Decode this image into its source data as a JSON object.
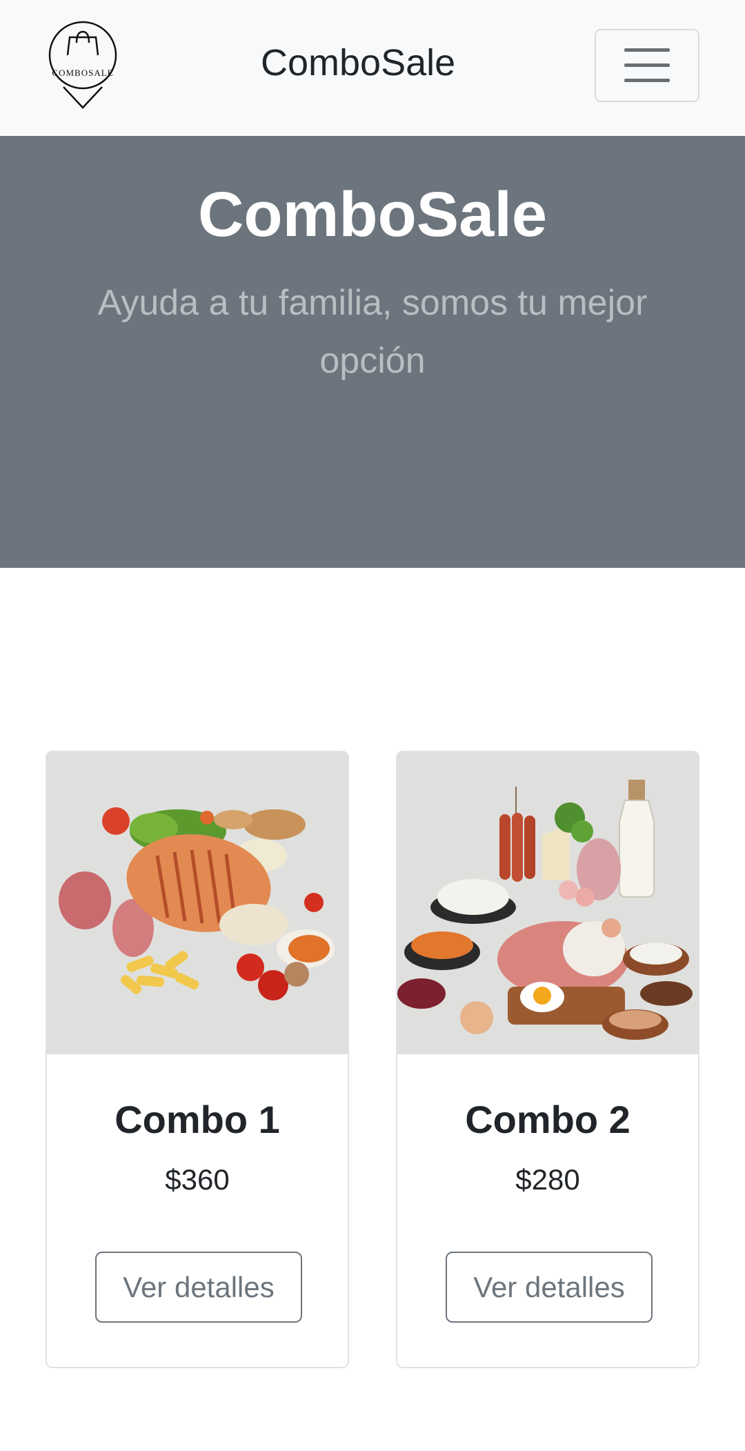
{
  "navbar": {
    "logo_text": "COMBOSALE",
    "brand": "ComboSale",
    "menu_button_icon": "hamburger-menu-icon"
  },
  "hero": {
    "title": "ComboSale",
    "subtitle": "Ayuda a tu familia, somos tu mejor opción"
  },
  "products": [
    {
      "title": "Combo 1",
      "price": "$360",
      "button_label": "Ver detalles",
      "image": "grilled-meat-vegetables-photo"
    },
    {
      "title": "Combo 2",
      "price": "$280",
      "button_label": "Ver detalles",
      "image": "groceries-meat-dairy-photo"
    }
  ],
  "colors": {
    "navbar_bg": "#f8f9fa",
    "hero_bg": "#6c757d",
    "hero_title": "#ffffff",
    "hero_subtitle": "#b9bec3",
    "button_outline": "#6c757d"
  }
}
